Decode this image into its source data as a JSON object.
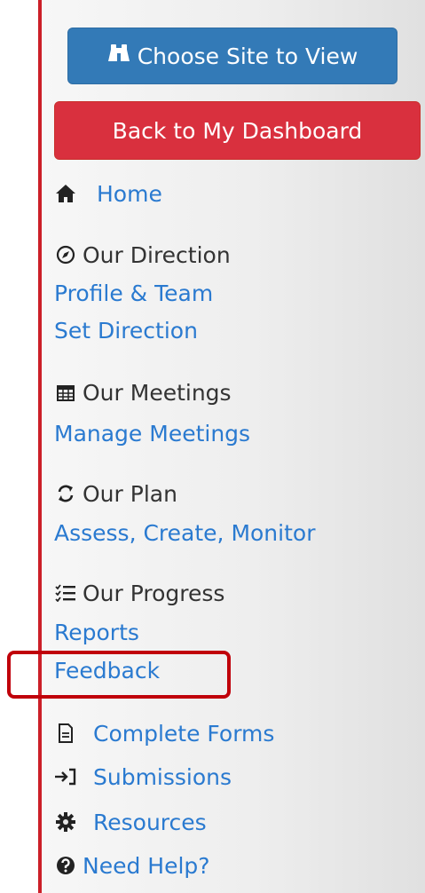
{
  "buttons": {
    "choose_site": "Choose Site to View",
    "back_dashboard": "Back to My Dashboard"
  },
  "nav": {
    "home": "Home",
    "our_direction": "Our Direction",
    "profile_team": "Profile & Team",
    "set_direction": "Set Direction",
    "our_meetings": "Our Meetings",
    "manage_meetings": "Manage Meetings",
    "our_plan": "Our Plan",
    "assess_create_monitor": "Assess, Create, Monitor",
    "our_progress": "Our Progress",
    "reports": "Reports",
    "feedback": "Feedback",
    "complete_forms": "Complete Forms",
    "submissions": "Submissions",
    "resources": "Resources",
    "need_help": "Need Help?"
  },
  "icons": {
    "binoculars": "binoculars-icon",
    "home": "home-icon",
    "compass": "compass-icon",
    "calendar": "calendar-icon",
    "refresh": "refresh-icon",
    "tasks": "tasks-icon",
    "form": "form-icon",
    "sign_in": "sign-in-icon",
    "cog": "cog-icon",
    "question": "question-circle-icon"
  },
  "colors": {
    "primary_button": "#337ab7",
    "danger_button": "#d9303e",
    "link": "#2a7ad0",
    "highlight": "#c0000a",
    "left_rule": "#cc1f28"
  }
}
